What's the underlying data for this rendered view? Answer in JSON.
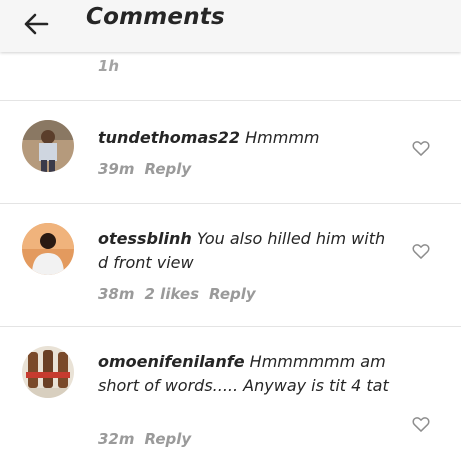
{
  "header": {
    "title": "Comments",
    "back_icon": "arrow-left-icon"
  },
  "previous_comment": {
    "time": "1h"
  },
  "comments": [
    {
      "username": "tundethomas22",
      "text": "Hmmmm",
      "time": "39m",
      "likes": "",
      "reply_label": "Reply"
    },
    {
      "username": "otessblinh",
      "text": "You also hilled him with d front view",
      "time": "38m",
      "likes": "2 likes",
      "reply_label": "Reply"
    },
    {
      "username": "omoenifenilanfe",
      "text": "Hmmmmmm am short of words..... Anyway is tit 4 tat",
      "time": "32m",
      "likes": "",
      "reply_label": "Reply"
    }
  ],
  "colors": {
    "header_bg": "#f6f6f6",
    "text": "#262626",
    "meta": "#9a9a9a",
    "divider": "#e4e4e4"
  }
}
